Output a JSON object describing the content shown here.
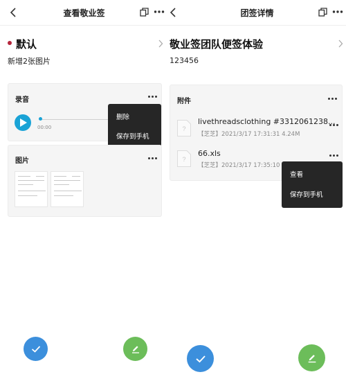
{
  "colors": {
    "accent_blue": "#3c8fdc",
    "accent_green": "#6cbd5a",
    "play_blue": "#1aa3d6",
    "category_dot": "#b5253c",
    "menu_bg": "#262626"
  },
  "left": {
    "header": {
      "title": "查看敬业签"
    },
    "category": {
      "label": "默认"
    },
    "description": "新增2张图片",
    "audio_card": {
      "title": "录音",
      "time": "00:00"
    },
    "audio_menu": {
      "items": [
        "删除",
        "保存到手机"
      ]
    },
    "image_card": {
      "title": "图片"
    }
  },
  "right": {
    "header": {
      "title": "团签详情"
    },
    "note_title": "敬业签团队便签体验",
    "description": "123456",
    "attachments": {
      "title": "附件",
      "files": [
        {
          "name": "livethreadsclothing #3312061238...",
          "meta": "【芝芝】2021/3/17 17:31:31 4.24M"
        },
        {
          "name": "66.xls",
          "meta": "【芝芝】2021/3/17 17:35:10 4."
        }
      ]
    },
    "file_menu": {
      "items": [
        "查看",
        "保存到手机"
      ]
    }
  }
}
